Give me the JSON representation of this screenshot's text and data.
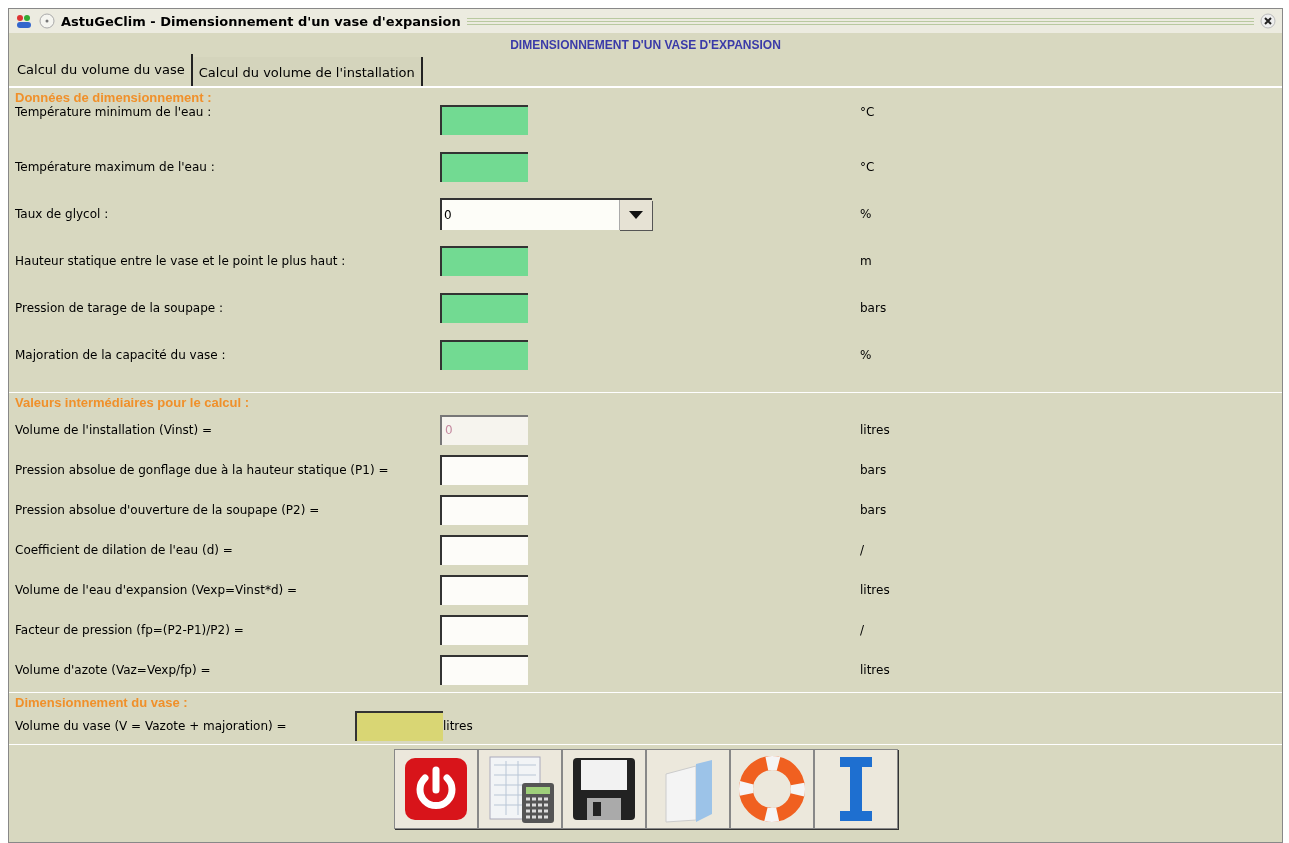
{
  "window": {
    "title": "AstuGeClim - Dimensionnement d'un vase d'expansion"
  },
  "heading": "DIMENSIONNEMENT D'UN VASE D'EXPANSION",
  "tabs": [
    {
      "label": "Calcul du volume du vase",
      "selected": true
    },
    {
      "label": "Calcul du volume de l'installation",
      "selected": false
    }
  ],
  "sections": [
    {
      "title": "Données de dimensionnement :",
      "rows": [
        {
          "label": "Température minimum de l'eau :",
          "kind": "input",
          "unit": "°C"
        },
        {
          "label": "Température maximum de l'eau :",
          "kind": "input",
          "unit": "°C"
        },
        {
          "label": "Taux de glycol :",
          "kind": "combo",
          "value": "0",
          "unit": "%"
        },
        {
          "label": "Hauteur statique entre le vase et le point le plus haut :",
          "kind": "input",
          "unit": "m"
        },
        {
          "label": "Pression de tarage de la soupape :",
          "kind": "input",
          "unit": "bars"
        },
        {
          "label": "Majoration de la capacité du vase :",
          "kind": "input",
          "unit": "%"
        }
      ]
    },
    {
      "title": "Valeurs intermédiaires pour le calcul :",
      "rows": [
        {
          "label": "Volume de l'installation (Vinst) =",
          "kind": "output",
          "value": "0",
          "disabled": true,
          "unit": "litres"
        },
        {
          "label": "Pression absolue de gonflage due à la hauteur statique (P1) =",
          "kind": "output",
          "disabled": false,
          "unit": "bars"
        },
        {
          "label": "Pression absolue d'ouverture de la soupape (P2) =",
          "kind": "output",
          "disabled": false,
          "unit": "bars"
        },
        {
          "label": "Coefficient de dilation de l'eau (d) =",
          "kind": "output",
          "disabled": false,
          "unit": "/"
        },
        {
          "label": "Volume de l'eau d'expansion (Vexp=Vinst*d) =",
          "kind": "output",
          "disabled": false,
          "unit": "litres"
        },
        {
          "label": "Facteur de pression (fp=(P2-P1)/P2) =",
          "kind": "output",
          "disabled": false,
          "unit": "/"
        },
        {
          "label": "Volume d'azote (Vaz=Vexp/fp) =",
          "kind": "output",
          "disabled": false,
          "unit": "litres"
        }
      ]
    },
    {
      "title": "Dimensionnement du vase :",
      "rows": [
        {
          "label": "Volume du vase (V = Vazote + majoration) =",
          "kind": "result",
          "unit": "litres"
        }
      ]
    }
  ],
  "toolbar": [
    {
      "kind": "power"
    },
    {
      "kind": "calculator"
    },
    {
      "kind": "save"
    },
    {
      "kind": "folder"
    },
    {
      "kind": "help"
    },
    {
      "kind": "info"
    }
  ]
}
